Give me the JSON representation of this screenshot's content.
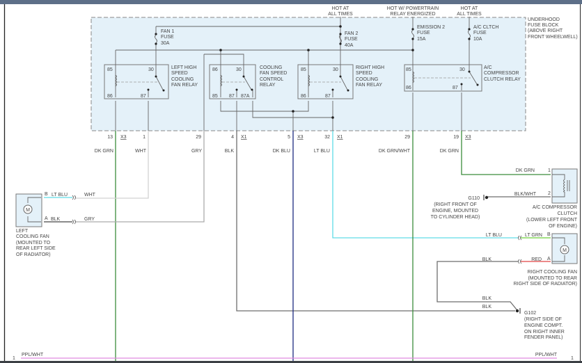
{
  "power_sources": [
    {
      "line1": "HOT AT",
      "line2": "ALL TIMES"
    },
    {
      "line1": "HOT W/ POWERTRAIN",
      "line2": "RELAY ENERGIZED"
    },
    {
      "line1": "HOT AT",
      "line2": "ALL TIMES"
    }
  ],
  "fuse_block": {
    "lines": [
      "UNDERHOOD",
      "FUSE BLOCK",
      "(ABOVE RIGHT",
      "FRONT WHEELWELL)"
    ]
  },
  "fuses": [
    {
      "name": "FAN 1",
      "type": "FUSE",
      "rating": "30A"
    },
    {
      "name": "FAN 2",
      "type": "FUSE",
      "rating": "40A"
    },
    {
      "name": "EMISSION 2",
      "type": "FUSE",
      "rating": "15A"
    },
    {
      "name": "A/C CLTCH",
      "type": "FUSE",
      "rating": "10A"
    }
  ],
  "relays": [
    {
      "lines": [
        "LEFT HIGH",
        "SPEED",
        "COOLING",
        "FAN RELAY"
      ],
      "pins": [
        "85",
        "30",
        "86",
        "87"
      ]
    },
    {
      "lines": [
        "COOLING",
        "FAN SPEED",
        "CONTROL",
        "RELAY"
      ],
      "pins": [
        "86",
        "30",
        "85",
        "87",
        "87A"
      ]
    },
    {
      "lines": [
        "RIGHT HIGH",
        "SPEED",
        "COOLING",
        "FAN RELAY"
      ],
      "pins": [
        "85",
        "30",
        "86",
        "87"
      ]
    },
    {
      "lines": [
        "A/C",
        "COMPRESSOR",
        "CLUTCH RELAY"
      ],
      "pins": [
        "85",
        "30",
        "86",
        "87"
      ]
    }
  ],
  "connectors": [
    {
      "pin": "13",
      "conn": "X3",
      "wire": "DK GRN"
    },
    {
      "pin": "1",
      "conn": "",
      "wire": "WHT"
    },
    {
      "pin": "29",
      "conn": "",
      "wire": "GRY"
    },
    {
      "pin": "4",
      "conn": "X1",
      "wire": "BLK"
    },
    {
      "pin": "5",
      "conn": "X3",
      "wire": "DK BLU"
    },
    {
      "pin": "32",
      "conn": "X1",
      "wire": "LT BLU"
    },
    {
      "pin": "29",
      "conn": "",
      "wire": "DK GRN/WHT"
    },
    {
      "pin": "19",
      "conn": "X3",
      "wire": "DK GRN"
    }
  ],
  "left_fan": {
    "pin_b": "B",
    "pin_b_wire": "LT BLU",
    "pin_b_harness": "WHT",
    "pin_a": "A",
    "pin_a_wire": "BLK",
    "pin_a_harness": "GRY",
    "motor": "M",
    "caption": [
      "LEFT",
      "COOLING FAN",
      "(MOUNTED TO",
      "REAR LEFT SIDE",
      "OF RADIATOR)"
    ]
  },
  "ac_clutch": {
    "pin1": "1",
    "pin1_wire": "DK GRN",
    "pin2": "2",
    "pin2_wire": "BLK/WHT",
    "caption": [
      "A/C COMPRESSOR",
      "CLUTCH",
      "(LOWER LEFT FRONT",
      "OF ENGINE)"
    ]
  },
  "g110": {
    "name": "G110",
    "caption": [
      "(RIGHT FRONT OF",
      "ENGINE, MOUNTED",
      "TO CYLINDER HEAD)"
    ]
  },
  "right_fan": {
    "pin_b": "B",
    "pin_b_harness": "LT BLU",
    "pin_b_wire": "LT GRN",
    "pin_a": "A",
    "pin_a_harness": "BLK",
    "pin_a_wire": "RED",
    "motor": "M",
    "caption": [
      "RIGHT COOLING FAN",
      "(MOUNTED TO REAR",
      "RIGHT SIDE OF RADIATOR)"
    ]
  },
  "g102": {
    "name": "G102",
    "wire1": "BLK",
    "wire2": "BLK",
    "caption": [
      "(RIGHT SIDE OF",
      "ENGINE COMPT.",
      "ON RIGHT INNER",
      "FENDER PANEL)"
    ]
  },
  "bottom_wire": {
    "left_pin": "1",
    "left_label": "PPL/WHT",
    "right_label": "PPL/WHT",
    "right_pin": "1"
  },
  "wire_colors": {
    "DK GRN": "#3b8c3b",
    "WHT": "#d2d2d2",
    "GRY": "#ababab",
    "BLK": "#6e6e6e",
    "DK BLU": "#1c2a80",
    "LT BLU": "#5fdce6",
    "LT GRN": "#6ccf3a",
    "RED": "#e04545",
    "PPL/WHT": "#e08ae0",
    "fuse_block_fill": "#e4f1f9"
  }
}
